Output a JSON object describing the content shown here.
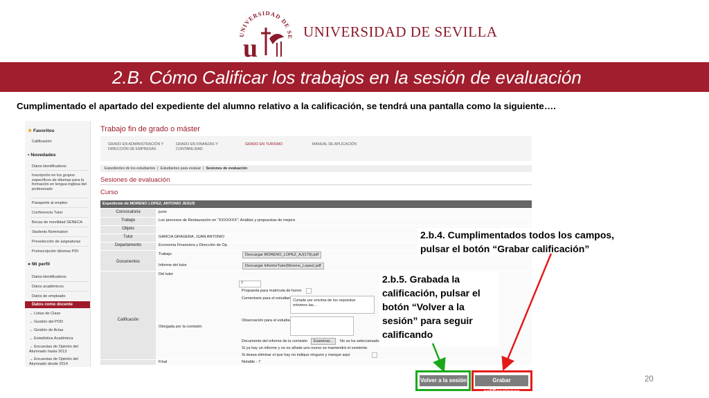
{
  "header": {
    "seal_text": "UNIVERSIDAD DE SEVILLA",
    "university": "UNIVERSIDAD DE SEVILLA",
    "title": "2.B. Cómo Calificar los trabajos en la sesión de evaluación",
    "intro": "Cumplimentado el apartado  del expediente del alumno relativo a la calificación, se tendrá una pantalla como la siguiente…."
  },
  "sidebar": {
    "favoritos": "Favoritos",
    "fav_items": [
      "Calificación"
    ],
    "novedades": "Novedades",
    "nov_items": [
      "Datos identificativos",
      "Inscripción en los grupos específicos de idiomas para la formación en lengua inglesa del profesorado",
      "Pasaporte al empleo",
      "Conferencia Tutor",
      "Becas de movilidad SENECA",
      "Students Nomination",
      "Preselección de asignaturas",
      "Preinscripción Idiomas PDI"
    ],
    "miperfil": "Mi perfil",
    "perfil_items": [
      "Datos identificativos",
      "Datos académicos",
      "Datos de empleado"
    ],
    "active": "Datos como docente",
    "sub_items": [
      "Listas de Clase",
      "Gestión del POD",
      "Gestión de Actas",
      "Estadística Académica",
      "Encuestas de Opinión del Alumnado hasta 2013",
      "Encuestas de Opinión del Alumnado desde 2014"
    ]
  },
  "app": {
    "heading": "Trabajo fin de grado o máster",
    "tabs": [
      "GRADO EN ADMINISTRACIÓN Y DIRECCIÓN DE EMPRESAS",
      "GRADO EN FINANZAS Y CONTABILIDAD",
      "GRADO EN TURISMO",
      "MANUAL DE APLICACIÓN"
    ],
    "breadcrumb": [
      "Expedientes de los estudiantes",
      "Estudiantes para evaluar",
      "Sesiones de evaluación"
    ],
    "section": "Sesiones de evaluación",
    "curso": "Curso",
    "expediente": "Expediente de MORENO LOPEZ, ANTONIO JESUS",
    "rows": {
      "convocatoria": {
        "label": "Convocatoria",
        "value": "junio"
      },
      "trabajo": {
        "label": "Trabajo",
        "value": "Los procesos de Restauración en \"XXXXXXX\": Análisis y propuestas de mejora"
      },
      "objeto": {
        "label": "Objeto",
        "value": ""
      },
      "tutor": {
        "label": "Tutor",
        "value": "GARCIA GRAGERA, JUAN ANTONIO"
      },
      "departamento": {
        "label": "Departamento",
        "value": "Economía Financiera y Dirección de Op."
      }
    },
    "documentos": {
      "label": "Documentos",
      "trabajo_label": "Trabajo",
      "trabajo_file": "Descargar MORENO_LOPEZ_AJ(179).pdf",
      "informe_label": "Informe del tutor",
      "informe_file": "Descargar InformeTutor(Moreno_Lopez).pdf"
    },
    "calificacion": {
      "label": "Calificación",
      "del_tutor": "Del tutor",
      "tutor_grade": "7",
      "propuesta": "Propuesta para matrícula de honor",
      "comentario": "Comentario para el estudiante",
      "comentario_text": "Cumple por encima de los requisitos mínimos las…",
      "otorgada": "Otorgada por la comisión",
      "observacion": "Observación para el estudiante",
      "documento": "Documento del informe de la comisión",
      "examinar": "Examinar...",
      "no_file": "No se ha seleccionado",
      "notice": "Si ya hay un informe y no se añade uno nuevo se mantendrá el existente.",
      "eliminar": "Si desea eliminar el que hay no indique ninguno y marque aquí"
    },
    "final": {
      "label": "Final",
      "value": "Notable - 7"
    }
  },
  "callouts": {
    "c1": "2.b.4.  Cumplimentados todos los campos, pulsar el botón “Grabar  calificación”",
    "c2": "2.b.5. Grabada la calificación, pulsar el botón “Volver a la sesión” para seguir calificando"
  },
  "buttons": {
    "volver": "Volver a la sesión",
    "grabar": "Grabar calificaciones"
  },
  "page_number": "20",
  "colors": {
    "brand": "#a01e2d",
    "green": "#1aa81a",
    "red": "#e41b1b"
  }
}
